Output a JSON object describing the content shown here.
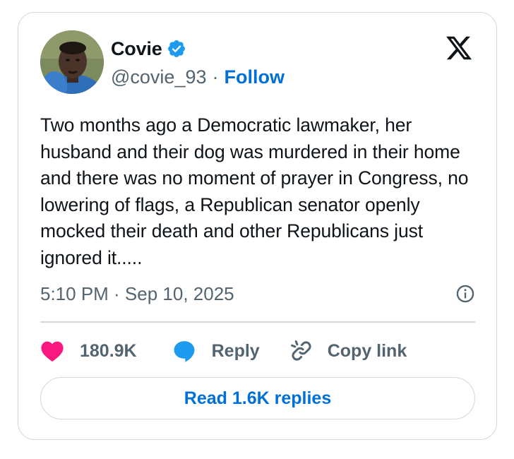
{
  "author": {
    "display_name": "Covie",
    "handle": "@covie_93",
    "verified": true,
    "separator": "·",
    "follow_label": "Follow"
  },
  "tweet": {
    "text": "Two months ago a Democratic lawmaker, her husband and their dog was murdered in their home and there was no moment of prayer in Congress, no lowering of flags, a Republican senator openly mocked their death and other Republicans just ignored it.....",
    "timestamp": "5:10 PM · Sep 10, 2025"
  },
  "actions": {
    "like_count": "180.9K",
    "reply_label": "Reply",
    "copy_link_label": "Copy link"
  },
  "read_replies_label": "Read 1.6K replies",
  "icons": {
    "brand": "x-logo-icon",
    "verified": "verified-badge-icon",
    "info": "info-icon",
    "like": "heart-icon",
    "reply": "speech-bubble-icon",
    "copy": "link-icon"
  },
  "colors": {
    "accent_blue": "#006fd6",
    "verified_blue": "#1d9bf0",
    "like_pink": "#f91880",
    "secondary_text": "#536471",
    "border": "#cfd9de"
  }
}
